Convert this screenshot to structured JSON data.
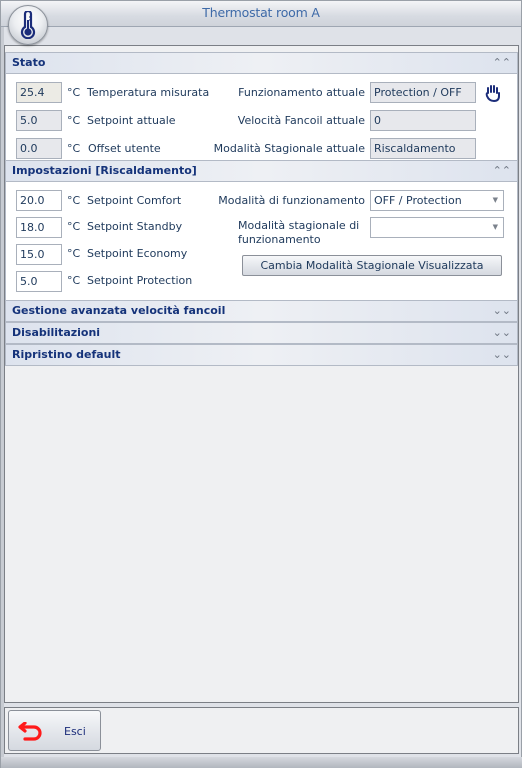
{
  "window": {
    "title": "Thermostat room A",
    "app_icon": "thermometer-icon"
  },
  "stato": {
    "header": "Stato",
    "collapse_icon": "chevron-double-up-icon",
    "left_rows": [
      {
        "value": "25.4",
        "unit": "°C",
        "label": "Temperatura misurata"
      },
      {
        "value": "5.0",
        "unit": "°C",
        "label": "Setpoint attuale"
      },
      {
        "value": "0.0",
        "unit": "°C",
        "label": "Offset utente"
      }
    ],
    "right_rows": [
      {
        "label": "Funzionamento attuale",
        "value": "Protection / OFF"
      },
      {
        "label": "Velocità Fancoil attuale",
        "value": "0"
      },
      {
        "label": "Modalità Stagionale attuale",
        "value": "Riscaldamento"
      }
    ],
    "manual_icon": "hand-icon"
  },
  "impostazioni": {
    "header": "Impostazioni [Riscaldamento]",
    "collapse_icon": "chevron-double-up-icon",
    "setpoints": [
      {
        "value": "20.0",
        "unit": "°C",
        "label": "Setpoint Comfort"
      },
      {
        "value": "18.0",
        "unit": "°C",
        "label": "Setpoint Standby"
      },
      {
        "value": "15.0",
        "unit": "°C",
        "label": "Setpoint Economy"
      },
      {
        "value": "5.0",
        "unit": "°C",
        "label": "Setpoint Protection"
      }
    ],
    "mode_label": "Modalità di funzionamento",
    "mode_value": "OFF / Protection",
    "seasonal_label_line1": "Modalità stagionale di",
    "seasonal_label_line2": "funzionamento",
    "seasonal_value": "",
    "change_button": "Cambia Modalità Stagionale Visualizzata"
  },
  "collapsed_sections": [
    {
      "header": "Gestione avanzata velocità fancoil"
    },
    {
      "header": "Disabilitazioni"
    },
    {
      "header": "Ripristino default"
    }
  ],
  "footer": {
    "exit_label": "Esci",
    "exit_icon": "back-arrow-icon"
  }
}
